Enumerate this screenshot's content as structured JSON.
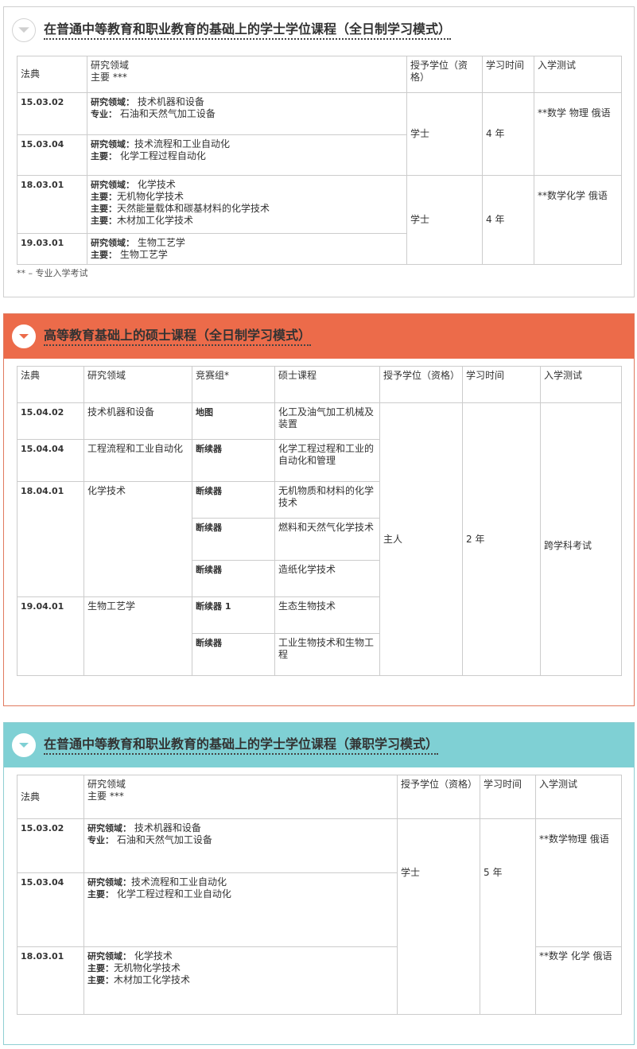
{
  "s1": {
    "title": "在普通中等教育和职业教育的基础上的学士学位课程（全日制学习模式）",
    "head": {
      "code": "法典",
      "field": "研究领域",
      "major": "主要 ***",
      "degree": "授予学位（资格）",
      "duration": "学习时间",
      "exam": "入学测试"
    },
    "rows": [
      {
        "code": "15.03.02",
        "l1": "研究领域：",
        "v1": "技术机器和设备",
        "l2": "专业：",
        "v2": "石油和天然气加工设备"
      },
      {
        "code": "15.03.04",
        "l1": "研究领域：",
        "v1": "技术流程和工业自动化",
        "l2": "主要：",
        "v2": "化学工程过程自动化"
      },
      {
        "code": "18.03.01",
        "l1": "研究领域：",
        "v1": "化学技术",
        "l2": "主要：",
        "v2": "无机物化学技术",
        "l3": "主要：",
        "v3": "天然能量载体和碳基材料的化学技术",
        "l4": "主要：",
        "v4": "木材加工化学技术"
      },
      {
        "code": "19.03.01",
        "l1": "研究领域：",
        "v1": "生物工艺学",
        "l2": "主要：",
        "v2": "生物工艺学"
      }
    ],
    "group1": {
      "degree": "学士",
      "duration": "4 年",
      "exam": "**数学 物理 俄语"
    },
    "group2": {
      "degree": "学士",
      "duration": "4 年",
      "exam": "**数学化学 俄语"
    },
    "note": "** – 专业入学考试"
  },
  "s2": {
    "title": "高等教育基础上的硕士课程（全日制学习模式）",
    "head": {
      "code": "法典",
      "field": "研究领域",
      "group": "竞赛组*",
      "program": "硕士课程",
      "degree": "授予学位（资格）",
      "duration": "学习时间",
      "exam": "入学测试"
    },
    "rows": [
      {
        "code": "15.04.02",
        "field": "技术机器和设备",
        "group": "地图",
        "program": "化工及油气加工机械及装置"
      },
      {
        "code": "15.04.04",
        "field": "工程流程和工业自动化",
        "group": "断续器",
        "program": "化学工程过程和工业的自动化和管理"
      },
      {
        "code": "18.04.01",
        "field": "化学技术",
        "group": "断续器",
        "program": "无机物质和材料的化学技术"
      },
      {
        "group": "断续器",
        "program": "燃料和天然气化学技术"
      },
      {
        "group": "断续器",
        "program": "造纸化学技术"
      },
      {
        "code": "19.04.01",
        "field": "生物工艺学",
        "group": "断续器 1",
        "program": "生态生物技术"
      },
      {
        "group": "断续器",
        "program": "工业生物技术和生物工程"
      }
    ],
    "degree": "主人",
    "duration": "2 年",
    "exam": "跨学科考试"
  },
  "s3": {
    "title": "在普通中等教育和职业教育的基础上的学士学位课程（兼职学习模式）",
    "head": {
      "code": "法典",
      "field": "研究领域",
      "major": "主要 ***",
      "degree": "授予学位（资格）",
      "duration": "学习时间",
      "exam": "入学测试"
    },
    "rows": [
      {
        "code": "15.03.02",
        "l1": "研究领域：",
        "v1": "技术机器和设备",
        "l2": "专业：",
        "v2": "石油和天然气加工设备"
      },
      {
        "code": "15.03.04",
        "l1": "研究领域：",
        "v1": "技术流程和工业自动化",
        "l2": "主要：",
        "v2": "化学工程过程和工业自动化"
      },
      {
        "code": "18.03.01",
        "l1": "研究领域：",
        "v1": "化学技术",
        "l2": "主要：",
        "v2": "无机物化学技术",
        "l3": "主要：",
        "v3": "木材加工化学技术"
      }
    ],
    "degree": "学士",
    "duration": "5 年",
    "exam1": "**数学物理 俄语",
    "exam2": "**数学 化学 俄语"
  },
  "colors": {
    "orange": "#ec6b4a",
    "teal": "#7fd0d4",
    "border": "#cccccc"
  },
  "icons": {
    "toggle": "chevron-down-icon"
  }
}
